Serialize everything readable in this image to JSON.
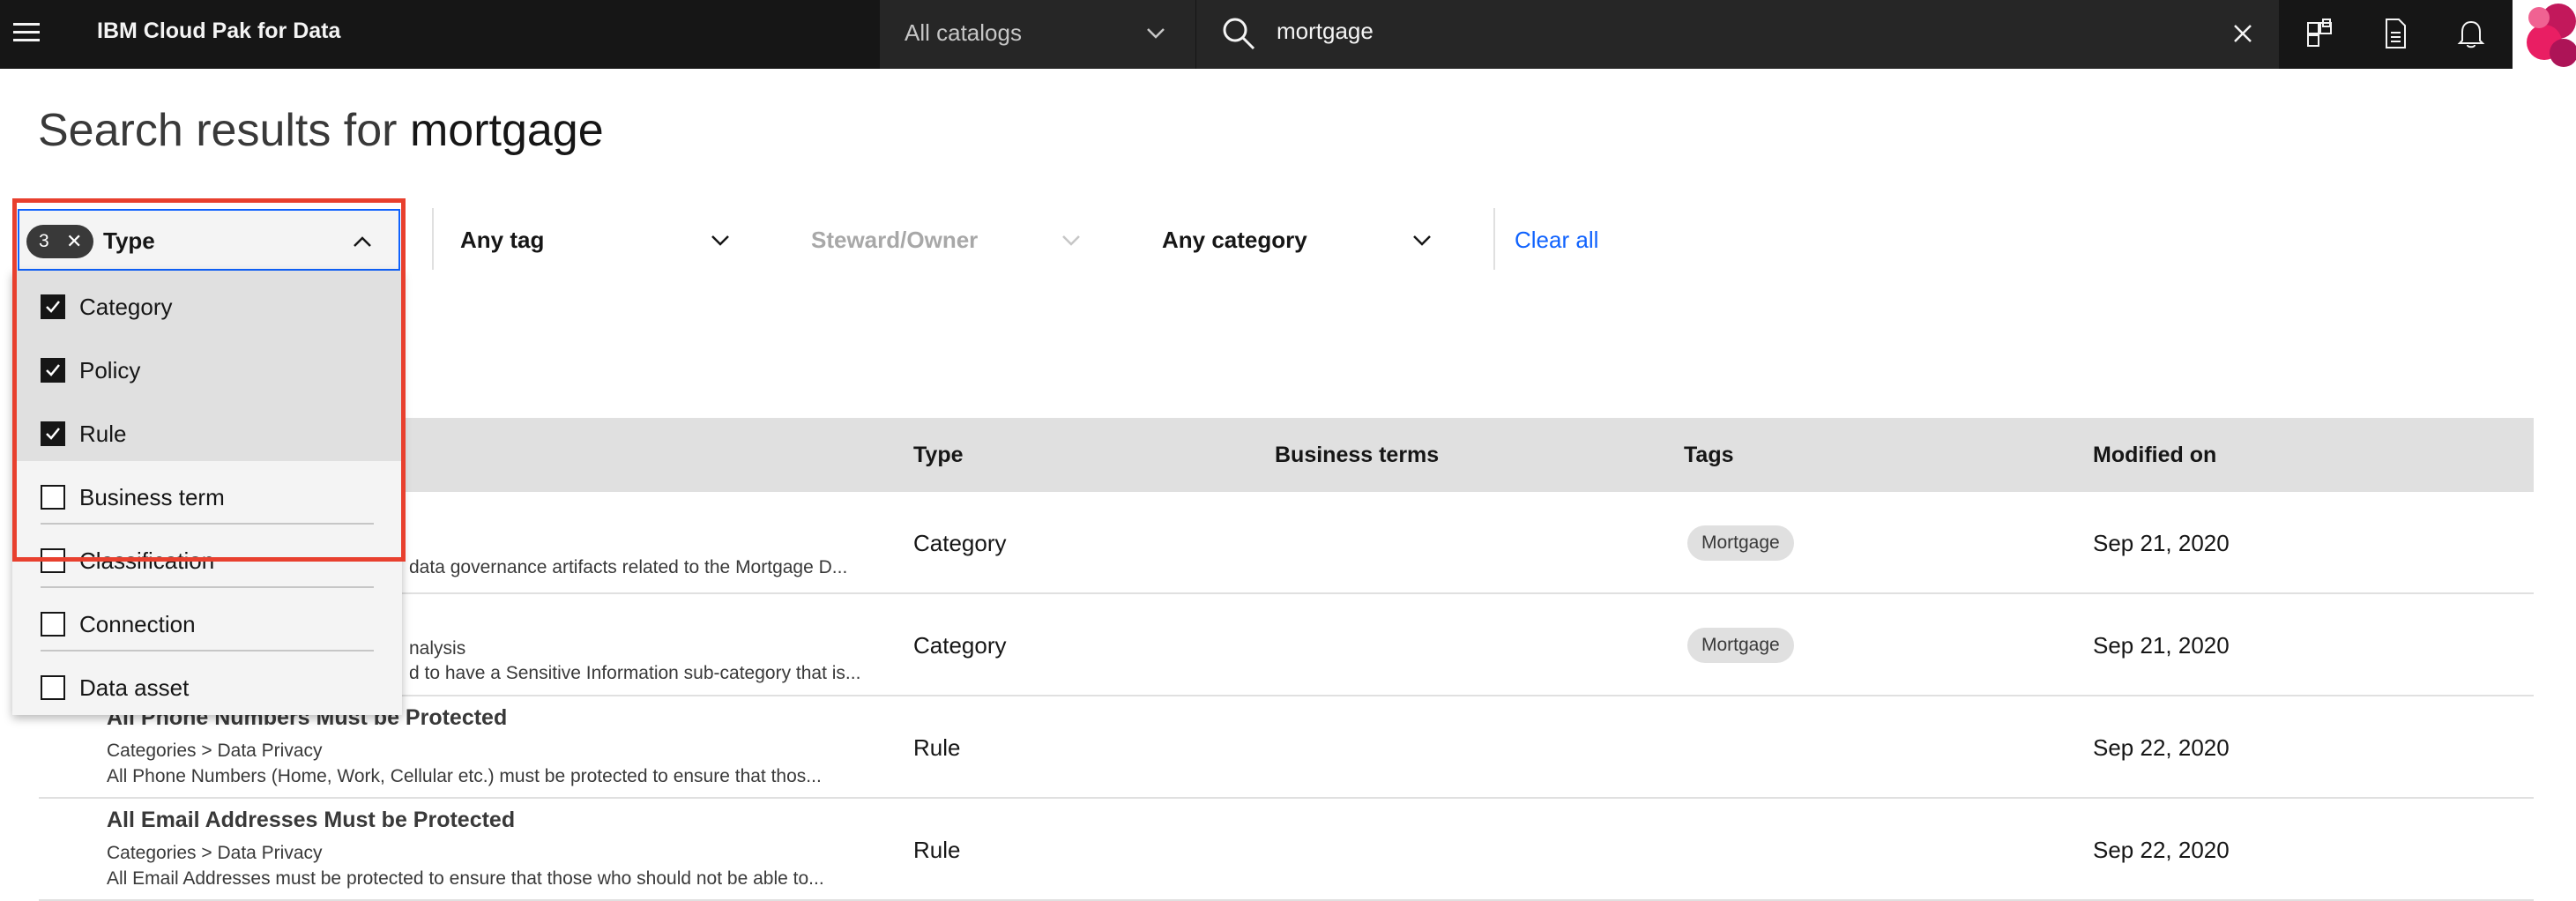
{
  "header": {
    "brand": "IBM Cloud Pak for Data",
    "catalog_select": "All catalogs",
    "search_value": "mortgage"
  },
  "page": {
    "title_prefix": "Search results for ",
    "title_query": "mortgage"
  },
  "filters": {
    "type": {
      "count": "3",
      "label": "Type"
    },
    "tag": "Any tag",
    "steward": "Steward/Owner",
    "category": "Any category",
    "clear_all": "Clear all"
  },
  "type_menu": {
    "items": [
      {
        "label": "Category",
        "checked": true
      },
      {
        "label": "Policy",
        "checked": true
      },
      {
        "label": "Rule",
        "checked": true
      },
      {
        "label": "Business term",
        "checked": false
      },
      {
        "label": "Classification",
        "checked": false
      },
      {
        "label": "Connection",
        "checked": false
      },
      {
        "label": "Data asset",
        "checked": false
      }
    ]
  },
  "table": {
    "columns": [
      "Type",
      "Business terms",
      "Tags",
      "Modified on"
    ],
    "rows": [
      {
        "name": "",
        "path": "",
        "desc": "data governance artifacts related to the Mortgage D...",
        "type": "Category",
        "tag": "Mortgage",
        "modified": "Sep 21, 2020"
      },
      {
        "name": "",
        "path": "nalysis",
        "desc": "d to have a Sensitive Information sub-category that is...",
        "type": "Category",
        "tag": "Mortgage",
        "modified": "Sep 21, 2020"
      },
      {
        "name": "All Phone Numbers Must be Protected",
        "path": "Categories > Data Privacy",
        "desc": "All Phone Numbers (Home, Work, Cellular etc.) must be protected to ensure that thos...",
        "type": "Rule",
        "tag": "",
        "modified": "Sep 22, 2020"
      },
      {
        "name": "All Email Addresses Must be Protected",
        "path": "Categories > Data Privacy",
        "desc": "All Email Addresses must be protected to ensure that those who should not be able to...",
        "type": "Rule",
        "tag": "",
        "modified": "Sep 22, 2020"
      }
    ]
  },
  "colors": {
    "header_bg": "#161616",
    "accent": "#0f62fe",
    "highlight": "#e8402e"
  }
}
